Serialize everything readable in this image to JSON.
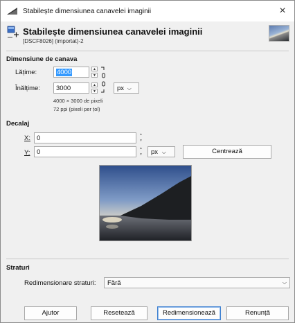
{
  "window": {
    "title": "Stabilește dimensiunea canavelei imaginii",
    "close_glyph": "×"
  },
  "header": {
    "title": "Stabilește dimensiunea canavelei imaginii",
    "subtitle": "[DSCF8026] (importat)-2"
  },
  "canvas_size": {
    "section": "Dimensiune de canava",
    "width_label": "Lățime:",
    "width_value": "4000",
    "height_label": "Înălțime:",
    "height_value": "3000",
    "unit": "px",
    "info_pixels": "4000 × 3000 de pixeli",
    "info_ppi": "72 ppi (pixeli per țol)"
  },
  "offset": {
    "section": "Decalaj",
    "x_label": "X:",
    "x_value": "0",
    "y_label": "Y:",
    "y_value": "0",
    "unit": "px",
    "center_button": "Centrează"
  },
  "layers": {
    "section": "Straturi",
    "resize_label": "Redimensionare straturi:",
    "resize_value": "Fără"
  },
  "buttons": {
    "help": "Ajutor",
    "reset": "Resetează",
    "resize": "Redimensionează",
    "cancel": "Renunță"
  },
  "colors": {
    "accent": "#3399ff",
    "default_button_border": "#3c7fd0"
  }
}
